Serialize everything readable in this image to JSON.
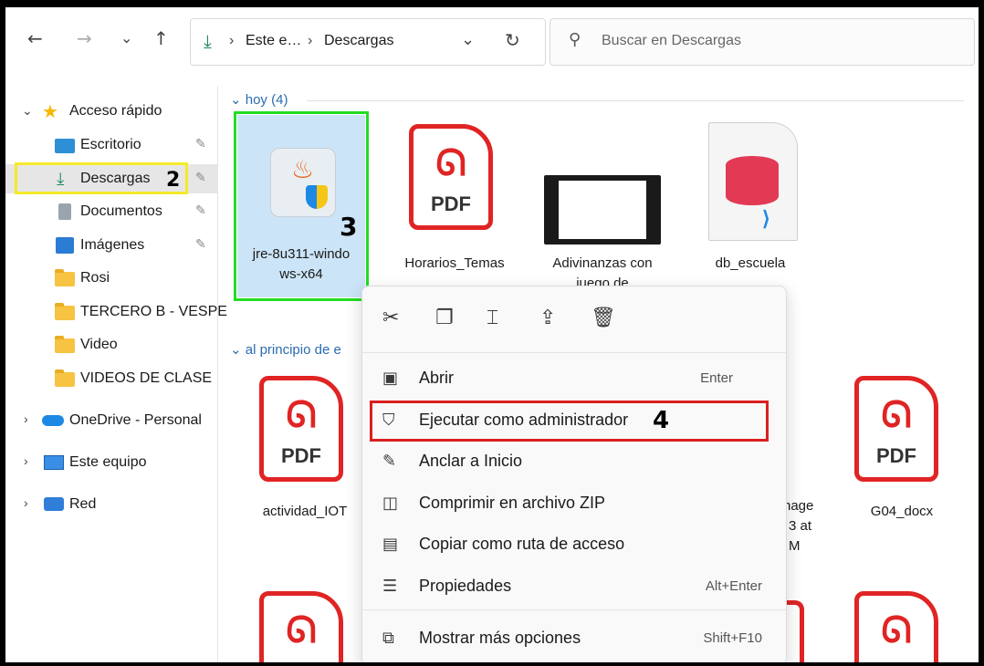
{
  "toolbar": {
    "back": "←",
    "forward": "→",
    "recent": "⌄",
    "up": "↑",
    "breadcrumb": [
      "Este e…",
      "Descargas"
    ],
    "refresh": "↻",
    "dropdown": "⌄",
    "search_placeholder": "Buscar en Descargas"
  },
  "sidebar": {
    "quick_access": "Acceso rápido",
    "items": [
      {
        "label": "Escritorio"
      },
      {
        "label": "Descargas"
      },
      {
        "label": "Documentos"
      },
      {
        "label": "Imágenes"
      },
      {
        "label": "Rosi"
      },
      {
        "label": "TERCERO B - VESPE"
      },
      {
        "label": "Video"
      },
      {
        "label": "VIDEOS DE CLASE"
      }
    ],
    "onedrive": "OneDrive - Personal",
    "this_pc": "Este equipo",
    "network": "Red"
  },
  "content": {
    "group1": "hoy (4)",
    "group2": "al principio de e",
    "tiles_today": [
      {
        "name1": "jre-8u311-windo",
        "name2": "ws-x64"
      },
      {
        "name1": "Horarios_Temas",
        "name2": ""
      },
      {
        "name1": "Adivinanzas con",
        "name2": "juego de"
      },
      {
        "name1": "db_escuela",
        "name2": ""
      }
    ],
    "tiles_earlier": [
      {
        "name1": "actividad_IOT"
      },
      {
        "name1": "nage",
        "name2": "3 at",
        "name3": "M"
      },
      {
        "name1": "G04_docx"
      }
    ],
    "pdf_text": "PDF"
  },
  "context_menu": {
    "top_icons": [
      "cut-icon",
      "copy-icon",
      "rename-icon",
      "share-icon",
      "delete-icon"
    ],
    "items": [
      {
        "label": "Abrir",
        "key": "Enter"
      },
      {
        "label": "Ejecutar como administrador",
        "key": ""
      },
      {
        "label": "Anclar a Inicio",
        "key": ""
      },
      {
        "label": "Comprimir en archivo ZIP",
        "key": ""
      },
      {
        "label": "Copiar como ruta de acceso",
        "key": ""
      },
      {
        "label": "Propiedades",
        "key": "Alt+Enter"
      },
      {
        "label": "Mostrar más opciones",
        "key": "Shift+F10"
      }
    ]
  },
  "annotations": {
    "n2": "2",
    "n3": "3",
    "n4": "4"
  },
  "colors": {
    "highlight_green": "#22dd22",
    "highlight_yellow": "#f5ea2a",
    "highlight_red": "#d92020",
    "selection": "#cce4f7"
  }
}
